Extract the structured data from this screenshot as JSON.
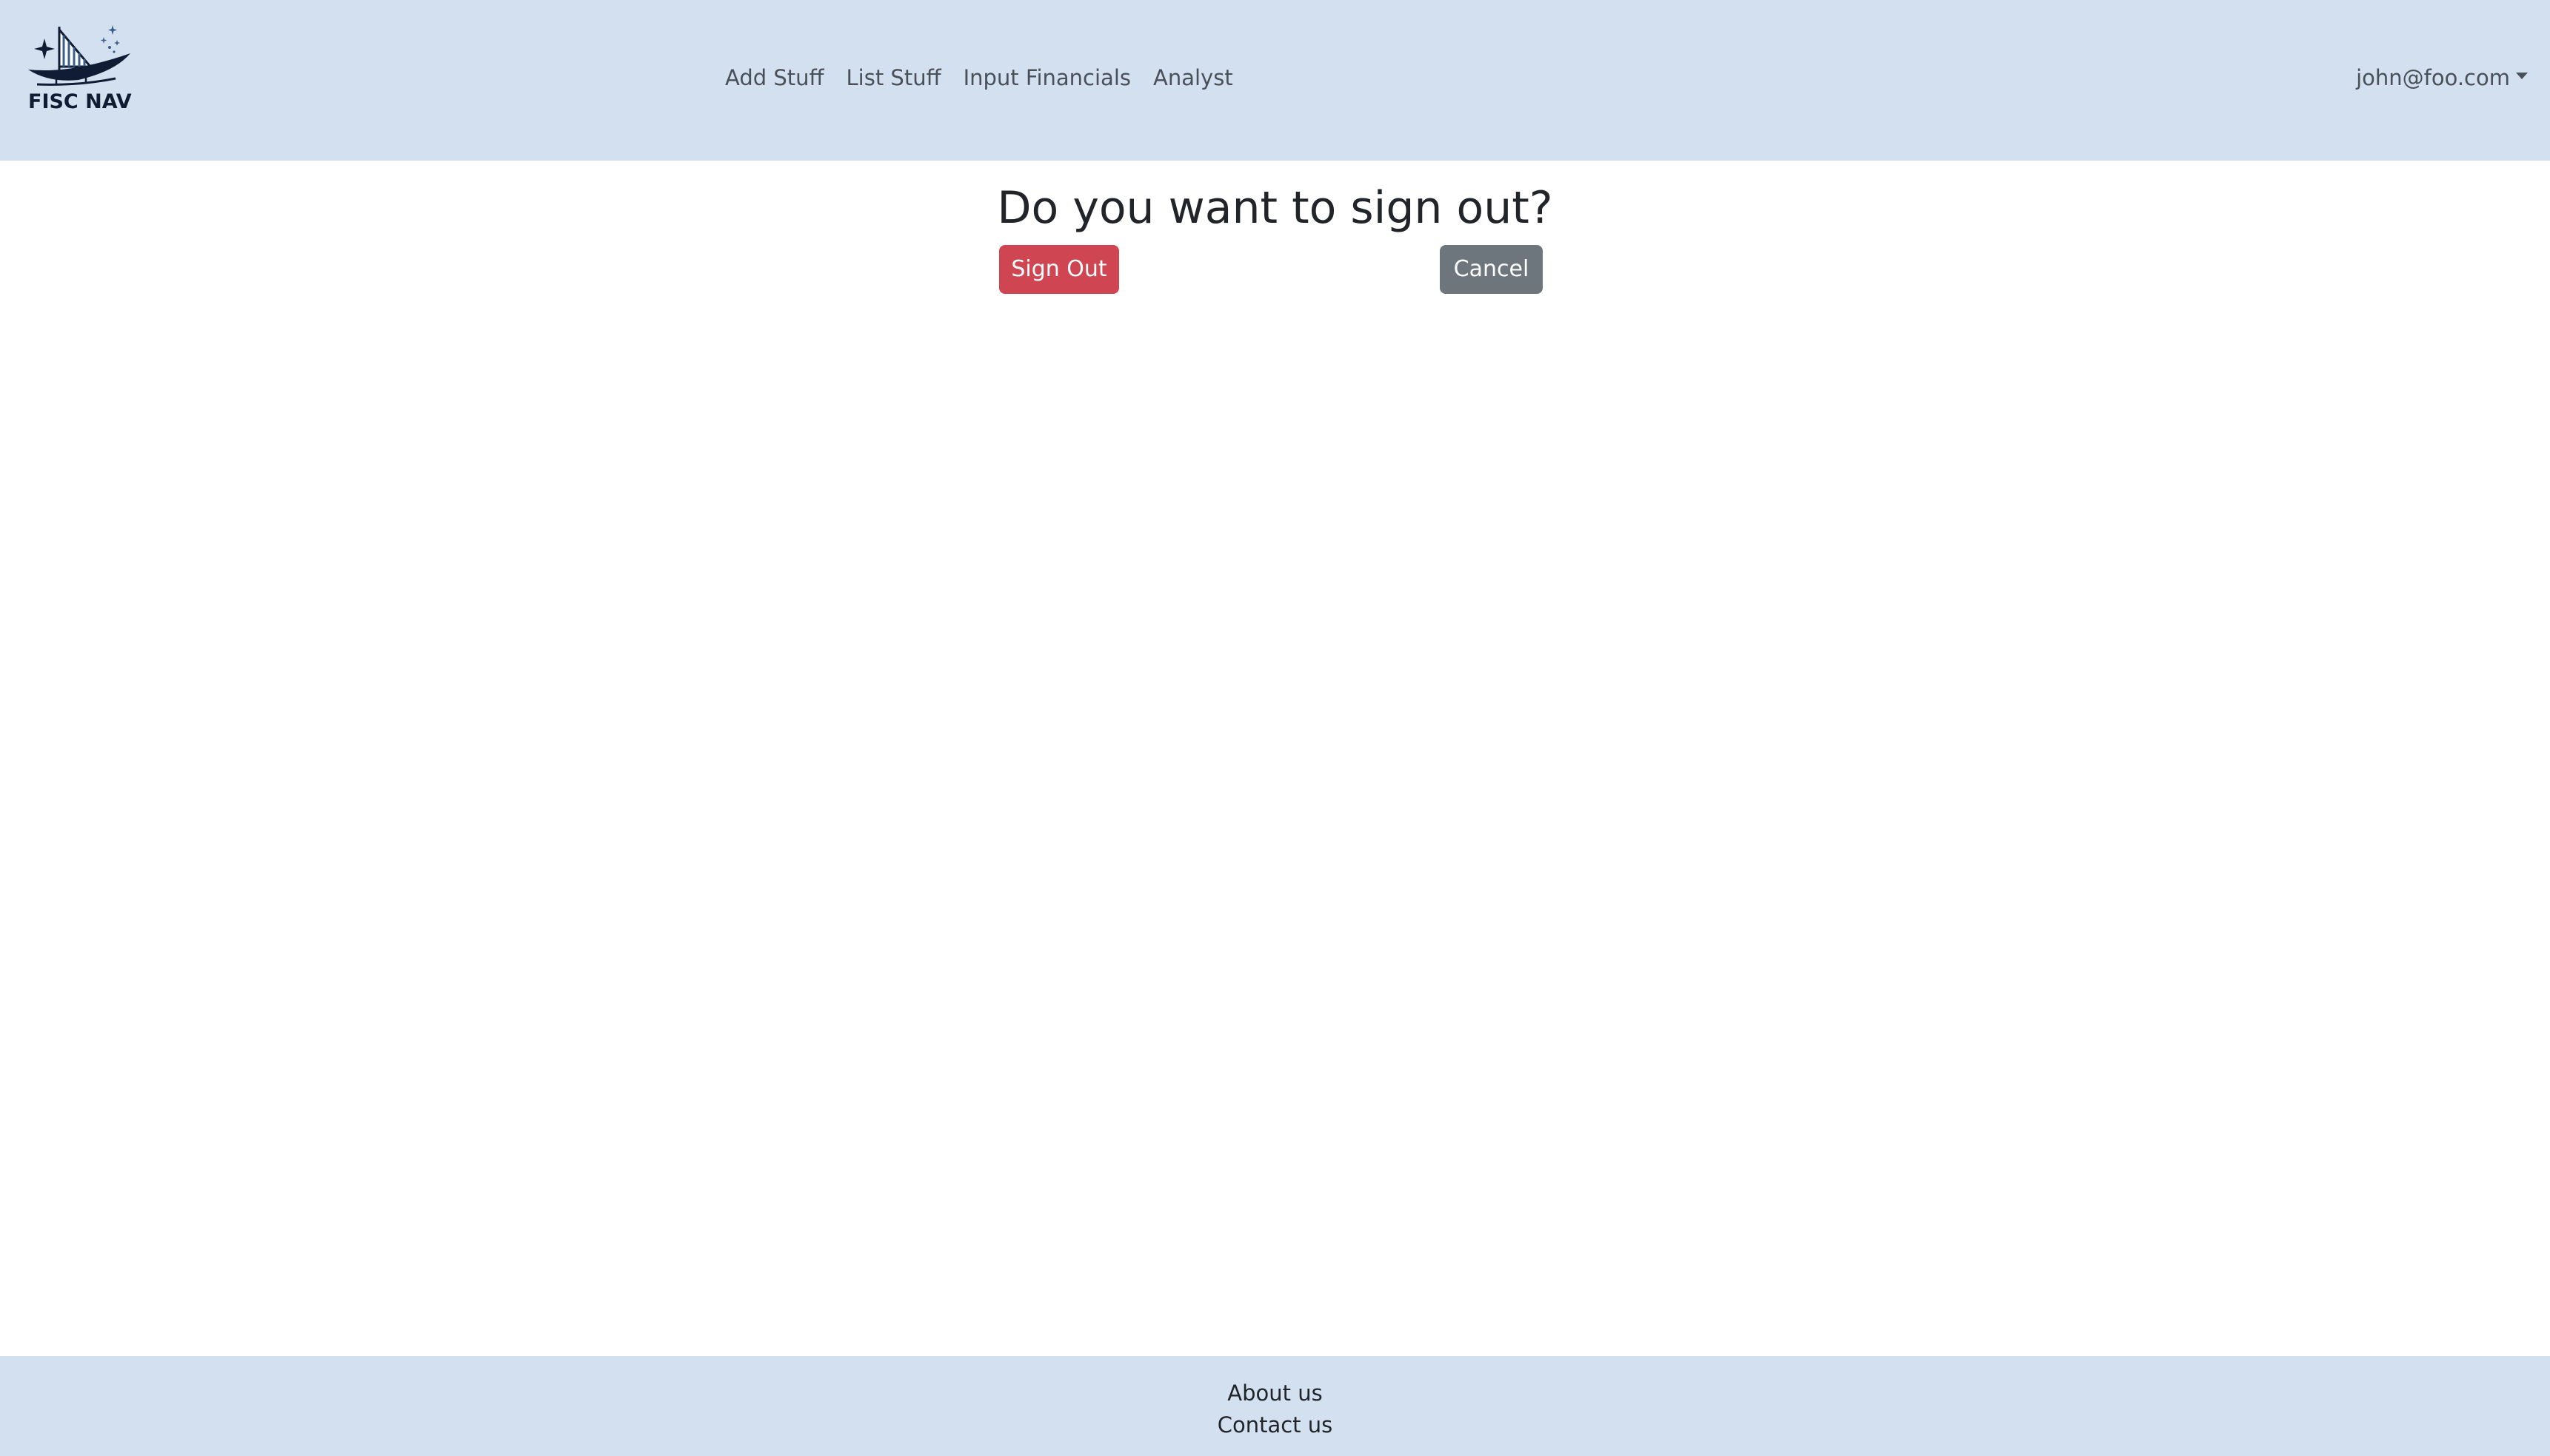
{
  "navbar": {
    "brand": {
      "text": "FISC NAV",
      "icon": "sailboat-stars-logo-icon"
    },
    "links": [
      {
        "label": "Add Stuff"
      },
      {
        "label": "List Stuff"
      },
      {
        "label": "Input Financials"
      },
      {
        "label": "Analyst"
      }
    ],
    "user": {
      "label": "john@foo.com",
      "icon": "caret-down-icon"
    },
    "background_color": "#d3e0f0"
  },
  "main": {
    "title": "Do you want to sign out?",
    "sign_out_label": "Sign Out",
    "cancel_label": "Cancel",
    "sign_out_color": "#cf4551",
    "cancel_color": "#6d757d"
  },
  "footer": {
    "about_label": "About us",
    "contact_label": "Contact us",
    "background_color": "#d3e0f0"
  }
}
